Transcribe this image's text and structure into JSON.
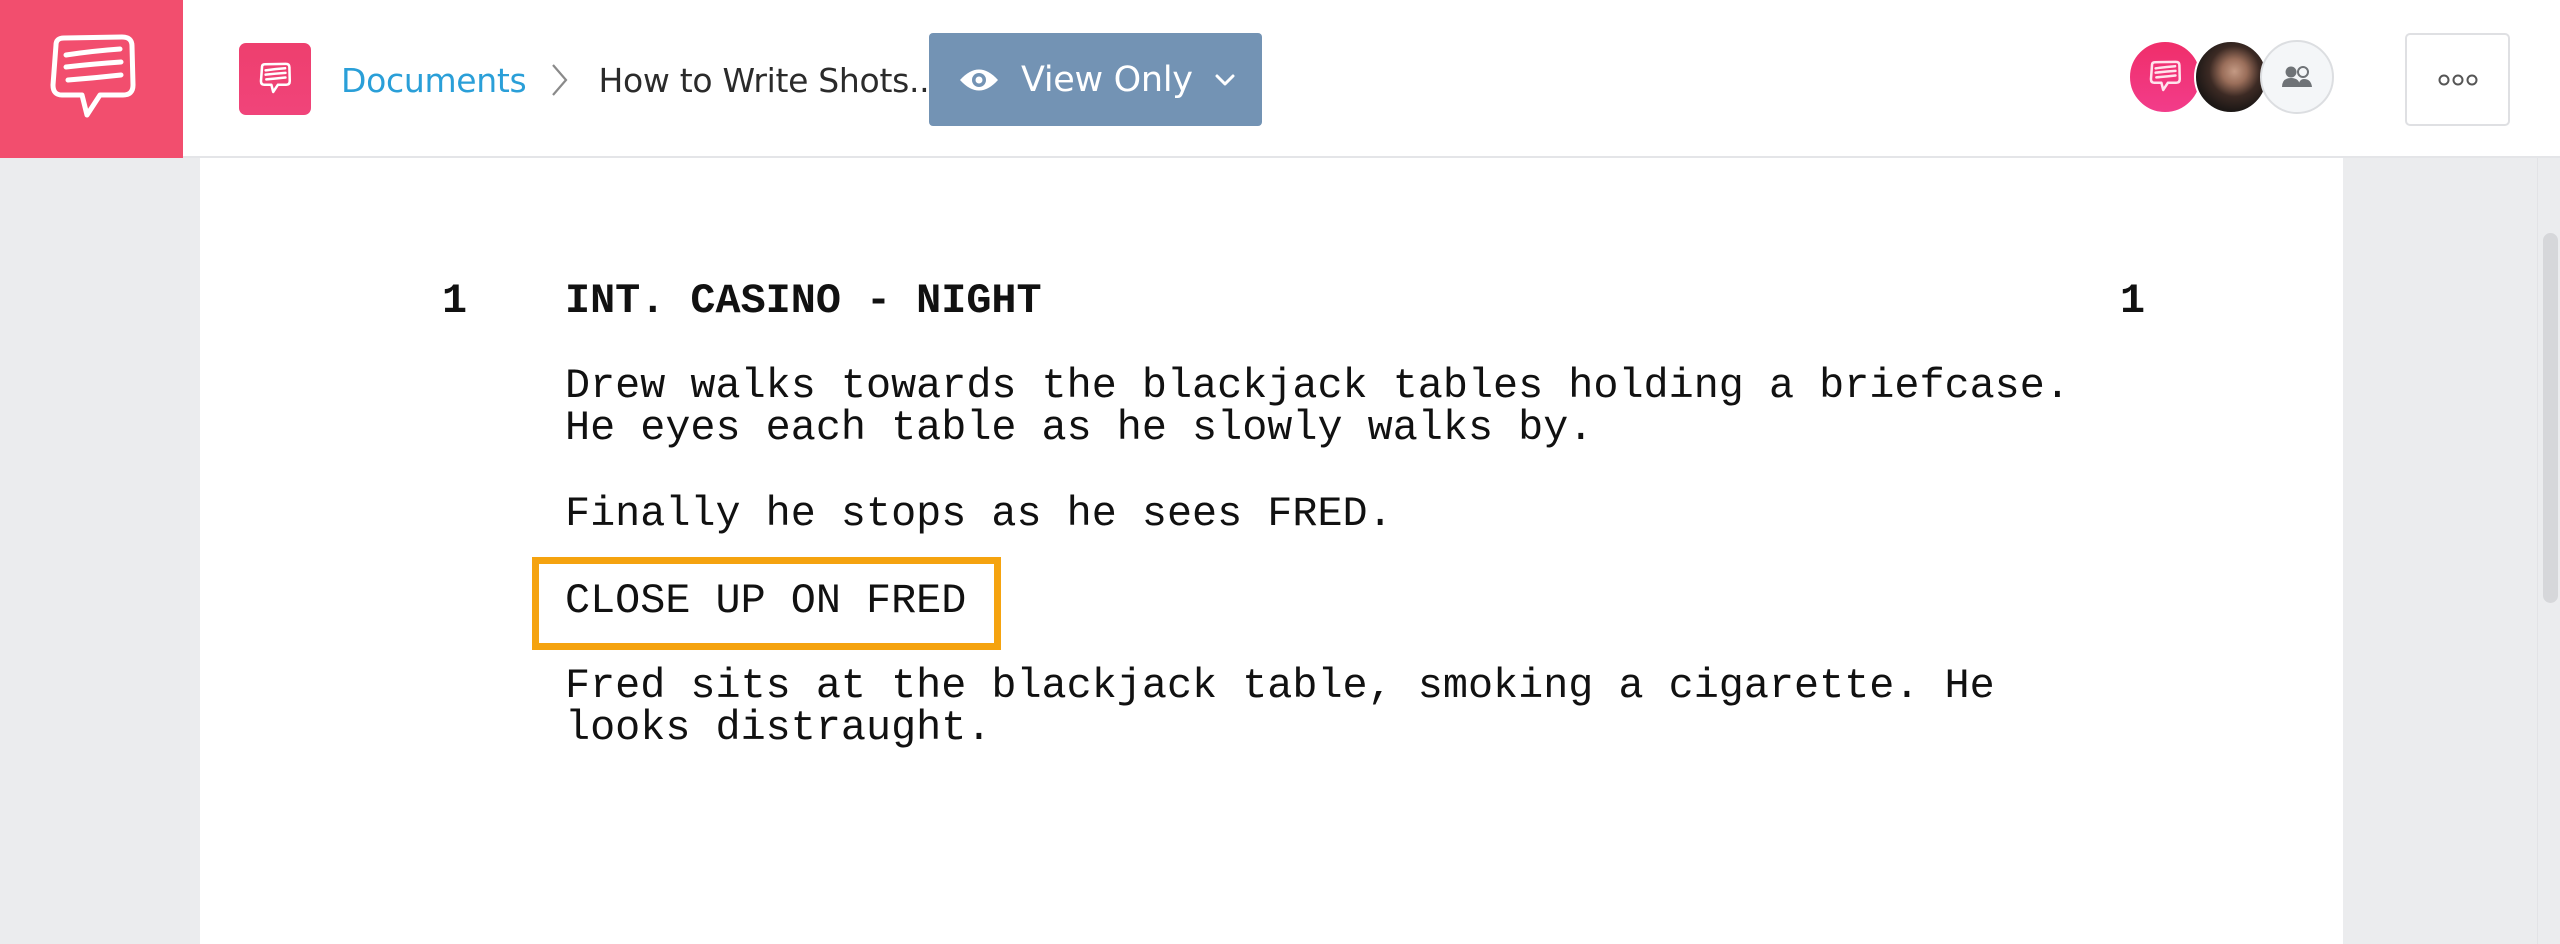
{
  "header": {
    "logo_icon": "speech-bubble-lines-icon",
    "brand_color": "#f24e6e",
    "doc_icon": "speech-bubble-lines-icon",
    "breadcrumb": {
      "root_label": "Documents",
      "separator_icon": "chevron-right-icon",
      "current_label": "How to Write Shots.."
    },
    "view_mode": {
      "icon": "eye-icon",
      "label": "View Only",
      "dropdown_icon": "chevron-down-icon",
      "color": "#7393b4"
    },
    "avatars": [
      {
        "type": "app-avatar",
        "icon": "speech-bubble-lines-icon"
      },
      {
        "type": "user-photo"
      },
      {
        "type": "collaborators",
        "icon": "users-icon"
      }
    ],
    "more_icon": "more-options-icon"
  },
  "script": {
    "scene_number": "1",
    "scene_heading": "INT. CASINO - NIGHT",
    "action_1": [
      "Drew walks towards the blackjack tables holding a briefcase.",
      "He eyes each table as he slowly walks by."
    ],
    "action_2": "Finally he stops as he sees FRED.",
    "shot": "CLOSE UP ON FRED",
    "shot_highlight_color": "#f5a30f",
    "action_3": [
      "Fred sits at the blackjack table, smoking a cigarette. He",
      "looks distraught."
    ]
  }
}
